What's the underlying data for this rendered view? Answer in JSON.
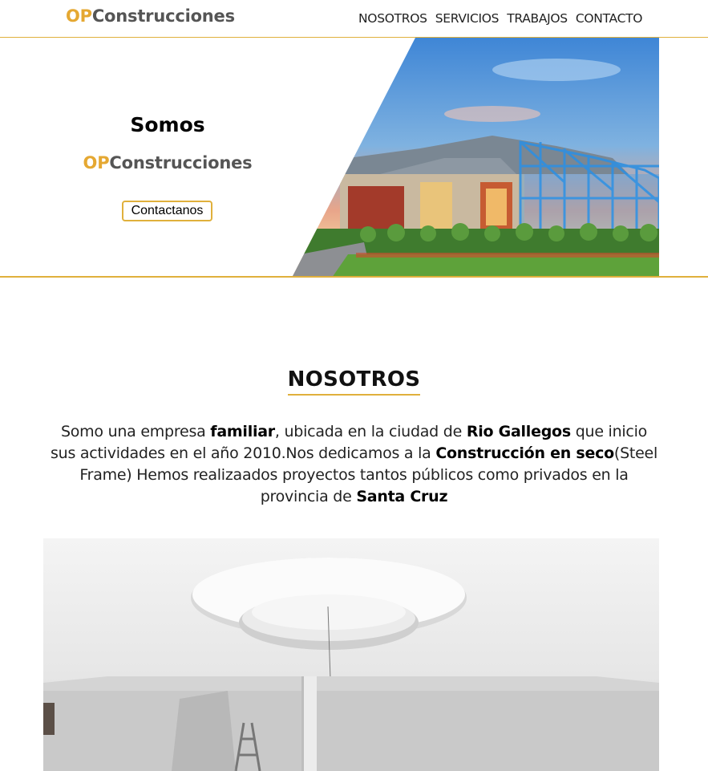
{
  "header": {
    "logo_accent": "OP",
    "logo_rest": "Construcciones",
    "nav": [
      {
        "label": "NOSOTROS"
      },
      {
        "label": "SERVICIOS"
      },
      {
        "label": "TRABAJOS"
      },
      {
        "label": "CONTACTO"
      }
    ]
  },
  "hero": {
    "title": "Somos",
    "brand_accent": "OP",
    "brand_rest": "Construcciones",
    "button_label": "Contactanos",
    "image": "house-steel-frame-photo"
  },
  "about": {
    "title": "NOSOTROS",
    "paragraph": [
      {
        "text": "Somo una empresa ",
        "bold": false
      },
      {
        "text": "familiar",
        "bold": true
      },
      {
        "text": ", ubicada en la ciudad de ",
        "bold": false
      },
      {
        "text": "Rio Gallegos",
        "bold": true
      },
      {
        "text": " que inicio sus actividades en el año 2010.Nos dedicamos a la ",
        "bold": false
      },
      {
        "text": "Construcción en seco",
        "bold": true
      },
      {
        "text": "(Steel Frame) Hemos realizaados proyectos tantos públicos como privados en la provincia de ",
        "bold": false
      },
      {
        "text": "Santa Cruz",
        "bold": true
      }
    ],
    "image": "ceiling-drywall-photo"
  },
  "colors": {
    "accent": "#e5a832",
    "border": "#e0b03c"
  }
}
